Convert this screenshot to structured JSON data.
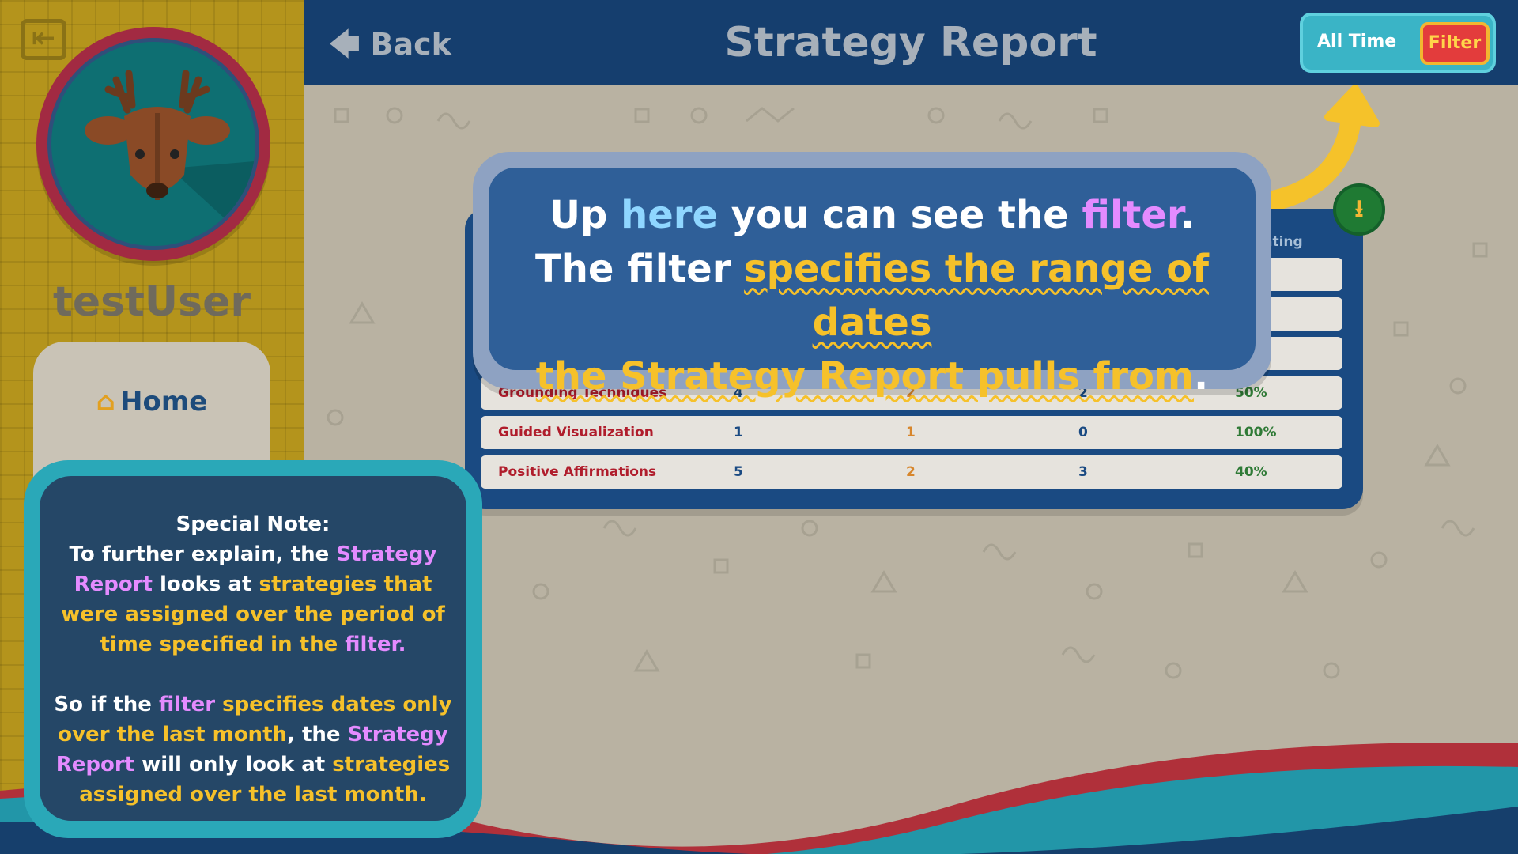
{
  "header": {
    "back_label": "Back",
    "title": "Strategy Report",
    "range_label": "All Time",
    "filter_label": "Filter"
  },
  "sidebar": {
    "username": "testUser",
    "home_label": "Home"
  },
  "table": {
    "rating_header_partial": "ating",
    "rows": [
      {
        "name": "Grounding Techniques",
        "c1": "4",
        "c2": "2",
        "c3": "2",
        "c4": "50%"
      },
      {
        "name": "Guided Visualization",
        "c1": "1",
        "c2": "1",
        "c3": "0",
        "c4": "100%"
      },
      {
        "name": "Positive Affirmations",
        "c1": "5",
        "c2": "2",
        "c3": "3",
        "c4": "40%"
      }
    ]
  },
  "callout": {
    "l1_a": "Up ",
    "l1_b": "here",
    "l1_c": " you can see the ",
    "l1_d": "filter",
    "l1_e": ".",
    "l2_a": "The filter ",
    "l2_b": "specifies the range of dates",
    "l3_a": "the Strategy Report pulls from",
    "l3_b": "."
  },
  "note": {
    "title": "Special Note:",
    "p1_a": "To further explain, the ",
    "p1_b": "Strategy Report",
    "p1_c": " looks at ",
    "p1_d": "strategies that were assigned over the period of time specified in the",
    "p1_e": " filter.",
    "p2_a": "So if the ",
    "p2_b": "filter",
    "p2_c": " specifies dates only over the last month",
    "p2_d": ", the ",
    "p2_e": "Strategy Report",
    "p2_f": " will only look at ",
    "p2_g": "strategies assigned over the last month."
  },
  "colors": {
    "header_bg": "#153e6e",
    "sidebar_bg": "#b4941c",
    "accent_gold": "#f6c12a",
    "accent_pink": "#e48bff",
    "accent_blue": "#8fd6ff",
    "filter_red": "#e33c3c",
    "teal": "#2aa8b8"
  },
  "icons": {
    "logout": "logout-icon",
    "back": "back-arrow-icon",
    "home": "house-icon",
    "download": "download-icon",
    "pointer": "curved-arrow-icon"
  }
}
